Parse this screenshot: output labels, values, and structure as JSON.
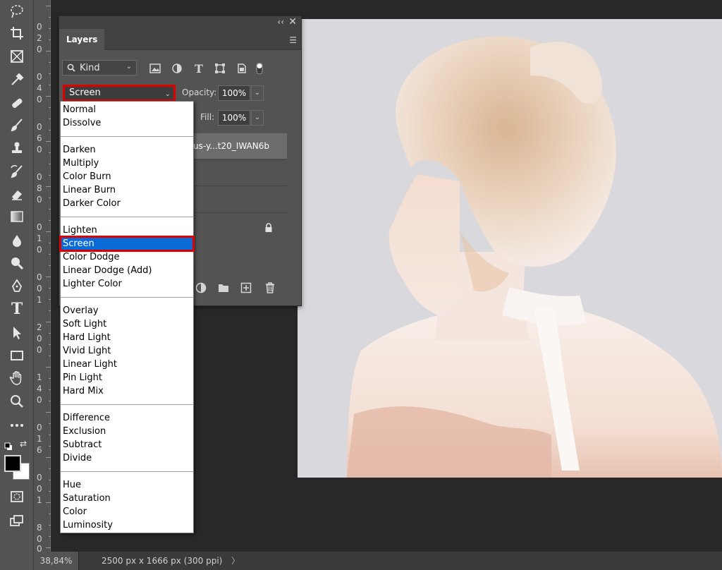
{
  "layers_panel": {
    "tab_title": "Layers",
    "collapse_icon": "double-chevron-icon",
    "close_icon": "close-icon",
    "filter_kind_label": "Kind",
    "blend_mode": "Screen",
    "opacity_label": "Opacity:",
    "opacity_value": "100%",
    "fill_label": "Fill:",
    "fill_value": "100%",
    "layer_name": "us-y...t20_IWAN6b"
  },
  "blend_dropdown": {
    "groups": [
      [
        "Normal",
        "Dissolve"
      ],
      [
        "Darken",
        "Multiply",
        "Color Burn",
        "Linear Burn",
        "Darker Color"
      ],
      [
        "Lighten",
        "Screen",
        "Color Dodge",
        "Linear Dodge (Add)",
        "Lighter Color"
      ],
      [
        "Overlay",
        "Soft Light",
        "Hard Light",
        "Vivid Light",
        "Linear Light",
        "Pin Light",
        "Hard Mix"
      ],
      [
        "Difference",
        "Exclusion",
        "Subtract",
        "Divide"
      ],
      [
        "Hue",
        "Saturation",
        "Color",
        "Luminosity"
      ]
    ],
    "selected": "Screen"
  },
  "ruler": {
    "digits": [
      "0",
      "2",
      "0",
      "0",
      "4",
      "0",
      "0",
      "6",
      "0",
      "0",
      "8",
      "0",
      "0",
      "1",
      "0",
      "0",
      "0",
      "1",
      "2",
      "0",
      "0",
      "1",
      "4",
      "0",
      "0",
      "1",
      "6",
      "0",
      "0",
      "1",
      "8",
      "0",
      "0"
    ]
  },
  "status": {
    "zoom": "38,84%",
    "doc_info": "2500 px x 1666 px (300 ppi)",
    "arrow": "〉"
  },
  "colors": {
    "foreground": "#000000",
    "background": "#ffffff",
    "highlight": "#0a6ad6",
    "annotation": "#e00000"
  }
}
